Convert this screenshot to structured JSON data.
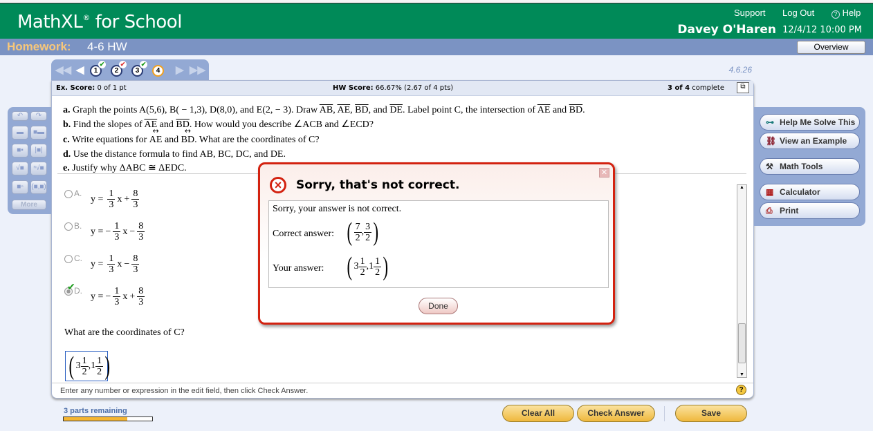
{
  "header": {
    "logo": "MathXL",
    "logo_mark": "®",
    "logo_suffix": " for School",
    "support": "Support",
    "logout": "Log Out",
    "help": "Help",
    "user": "Davey O'Haren",
    "datetime": "12/4/12 10:00 PM"
  },
  "hwbar": {
    "label": "Homework:",
    "name": "4-6 HW",
    "overview": "Overview"
  },
  "question_id": "4.6.26",
  "nav": {
    "questions": [
      {
        "n": "1",
        "status": "correct"
      },
      {
        "n": "2",
        "status": "partial"
      },
      {
        "n": "3",
        "status": "correct"
      },
      {
        "n": "4",
        "status": "current"
      }
    ]
  },
  "score": {
    "ex_label": "Ex. Score:",
    "ex_value": "0 of 1 pt",
    "hw_label": "HW Score:",
    "hw_value": "66.67% (2.67 of 4 pts)",
    "complete_bold": "3 of 4",
    "complete_text": "complete"
  },
  "questions": {
    "a_pre": "Graph the points A(5,6), B( − 1,3), D(8,0), and E(2, − 3). Draw ",
    "seg_ab": "AB",
    "seg_ae": "AE",
    "seg_bd": "BD",
    "seg_de": "DE",
    "a_post": ". Label point C, the intersection of ",
    "and": "and",
    "b_pre": "Find the slopes of ",
    "b_post": ". How would you describe ∠ACB and ∠ECD?",
    "c_pre": "Write equations for ",
    "c_post": ". What are the coordinates of C?",
    "d": "Use the distance formula to find AB, BC, DC, and DE.",
    "e": "Justify why ΔABC ≅ ΔEDC."
  },
  "choices": [
    {
      "letter": "A.",
      "lhs": "y =",
      "sign": "",
      "n1": "1",
      "d1": "3",
      "x": "x",
      "op": "+",
      "n2": "8",
      "d2": "3",
      "selected": false
    },
    {
      "letter": "B.",
      "lhs": "y =",
      "sign": "−",
      "n1": "1",
      "d1": "3",
      "x": "x",
      "op": "−",
      "n2": "8",
      "d2": "3",
      "selected": false
    },
    {
      "letter": "C.",
      "lhs": "y =",
      "sign": "",
      "n1": "1",
      "d1": "3",
      "x": "x",
      "op": "−",
      "n2": "8",
      "d2": "3",
      "selected": false
    },
    {
      "letter": "D.",
      "lhs": "y =",
      "sign": "−",
      "n1": "1",
      "d1": "3",
      "x": "x",
      "op": "+",
      "n2": "8",
      "d2": "3",
      "selected": true
    }
  ],
  "prompt_c": "What are the coordinates of C?",
  "answer": {
    "w1": "3",
    "n1": "1",
    "d1": "2",
    "w2": "1",
    "n2": "1",
    "d2": "2"
  },
  "hint": "Enter any number or expression in the edit field, then click Check Answer.",
  "toolbar": {
    "more": "More"
  },
  "right_panel": {
    "help_solve": "Help Me Solve This",
    "example": "View an Example",
    "math_tools": "Math Tools",
    "calculator": "Calculator",
    "print": "Print"
  },
  "dialog": {
    "title": "Sorry, that's not correct.",
    "message": "Sorry, your answer is not correct.",
    "correct_label": "Correct answer:",
    "correct": {
      "n1": "7",
      "d1": "2",
      "n2": "3",
      "d2": "2"
    },
    "your_label": "Your answer:",
    "your": {
      "w1": "3",
      "n1": "1",
      "d1": "2",
      "w2": "1",
      "n2": "1",
      "d2": "2"
    },
    "done": "Done"
  },
  "footer": {
    "parts_remaining": "3 parts remaining",
    "progress_percent": 72,
    "clear_all": "Clear All",
    "check_answer": "Check Answer",
    "save": "Save"
  },
  "colors": {
    "header_green": "#008a58",
    "bar_blue": "#7b93c3",
    "error_red": "#d32210",
    "button_gold": "#efb83c"
  }
}
